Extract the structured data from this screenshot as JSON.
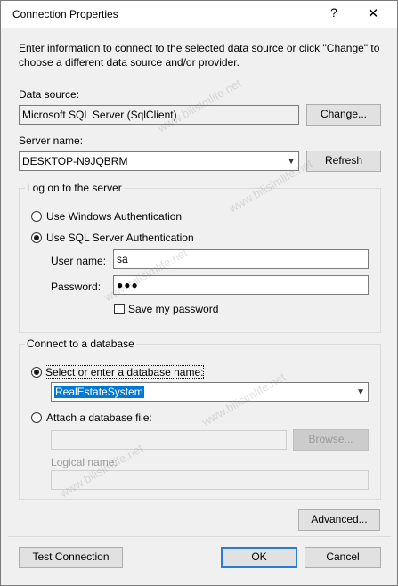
{
  "window": {
    "title": "Connection Properties",
    "help_glyph": "?",
    "close_glyph": "✕"
  },
  "intro": {
    "line1": "Enter information to connect to the selected data source or click \"Change\" to",
    "line2": "choose a different data source and/or provider."
  },
  "data_source": {
    "label": "Data source:",
    "value": "Microsoft SQL Server (SqlClient)",
    "change_label": "Change..."
  },
  "server": {
    "label": "Server name:",
    "value": "DESKTOP-N9JQBRM",
    "refresh_label": "Refresh"
  },
  "logon": {
    "group_label": "Log on to the server",
    "windows_auth_label": "Use Windows Authentication",
    "sql_auth_label": "Use SQL Server Authentication",
    "selected": "sql",
    "username_label": "User name:",
    "username_value": "sa",
    "password_label": "Password:",
    "password_value": "●●●",
    "save_password_label": "Save my password",
    "save_password_checked": false
  },
  "database": {
    "group_label": "Connect to a database",
    "select_label": "Select or enter a database name:",
    "db_name_value": "RealEstateSystem",
    "attach_label": "Attach a database file:",
    "attach_value": "",
    "browse_label": "Browse...",
    "logical_name_label": "Logical name:",
    "logical_name_value": "",
    "selected": "select"
  },
  "buttons": {
    "advanced_label": "Advanced...",
    "test_connection_label": "Test Connection",
    "ok_label": "OK",
    "cancel_label": "Cancel"
  },
  "watermark": {
    "text": "www.bilisimlife.net"
  },
  "icons": {
    "chevron": "chevron-down-icon",
    "close": "close-icon",
    "help": "help-icon"
  }
}
